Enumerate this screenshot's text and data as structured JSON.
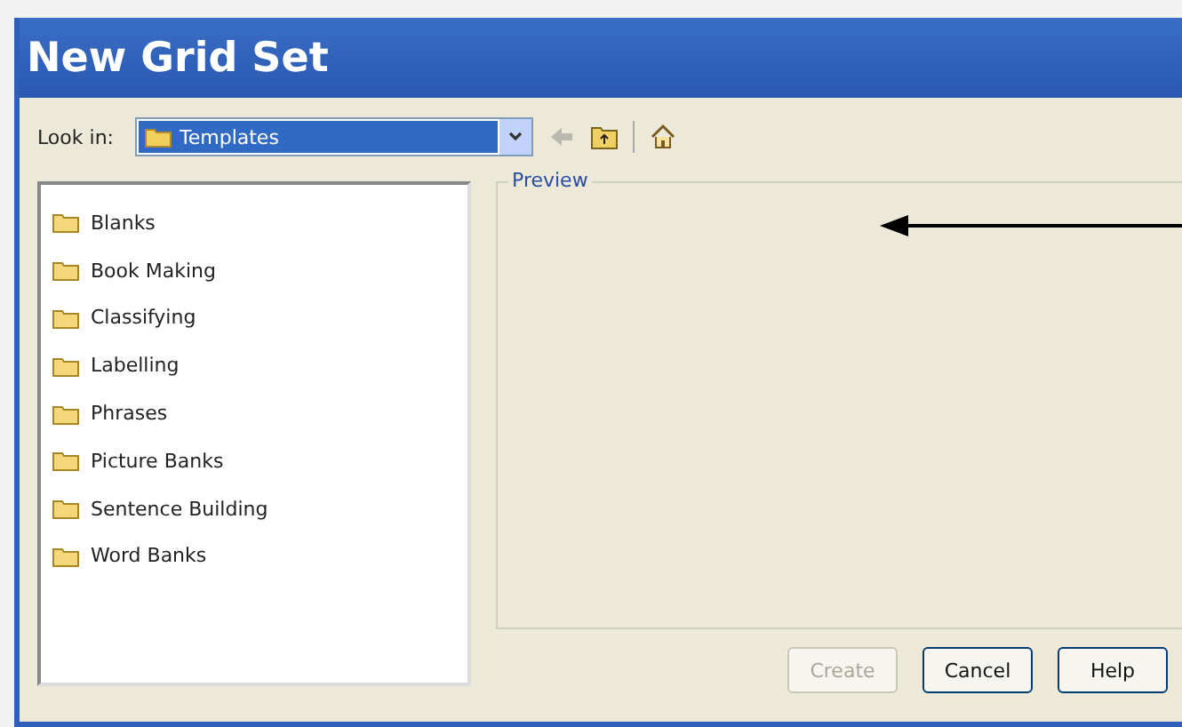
{
  "window": {
    "title": "New Grid Set"
  },
  "look_in": {
    "label": "Look in:",
    "value": "Templates"
  },
  "folders": [
    {
      "name": "Blanks"
    },
    {
      "name": "Book Making"
    },
    {
      "name": "Classifying"
    },
    {
      "name": "Labelling"
    },
    {
      "name": "Phrases"
    },
    {
      "name": "Picture Banks"
    },
    {
      "name": "Sentence Building"
    },
    {
      "name": "Word Banks"
    }
  ],
  "preview": {
    "label": "Preview"
  },
  "buttons": [
    {
      "label": "Create",
      "disabled": true
    },
    {
      "label": "Cancel",
      "disabled": false
    },
    {
      "label": "Help",
      "disabled": false
    }
  ]
}
